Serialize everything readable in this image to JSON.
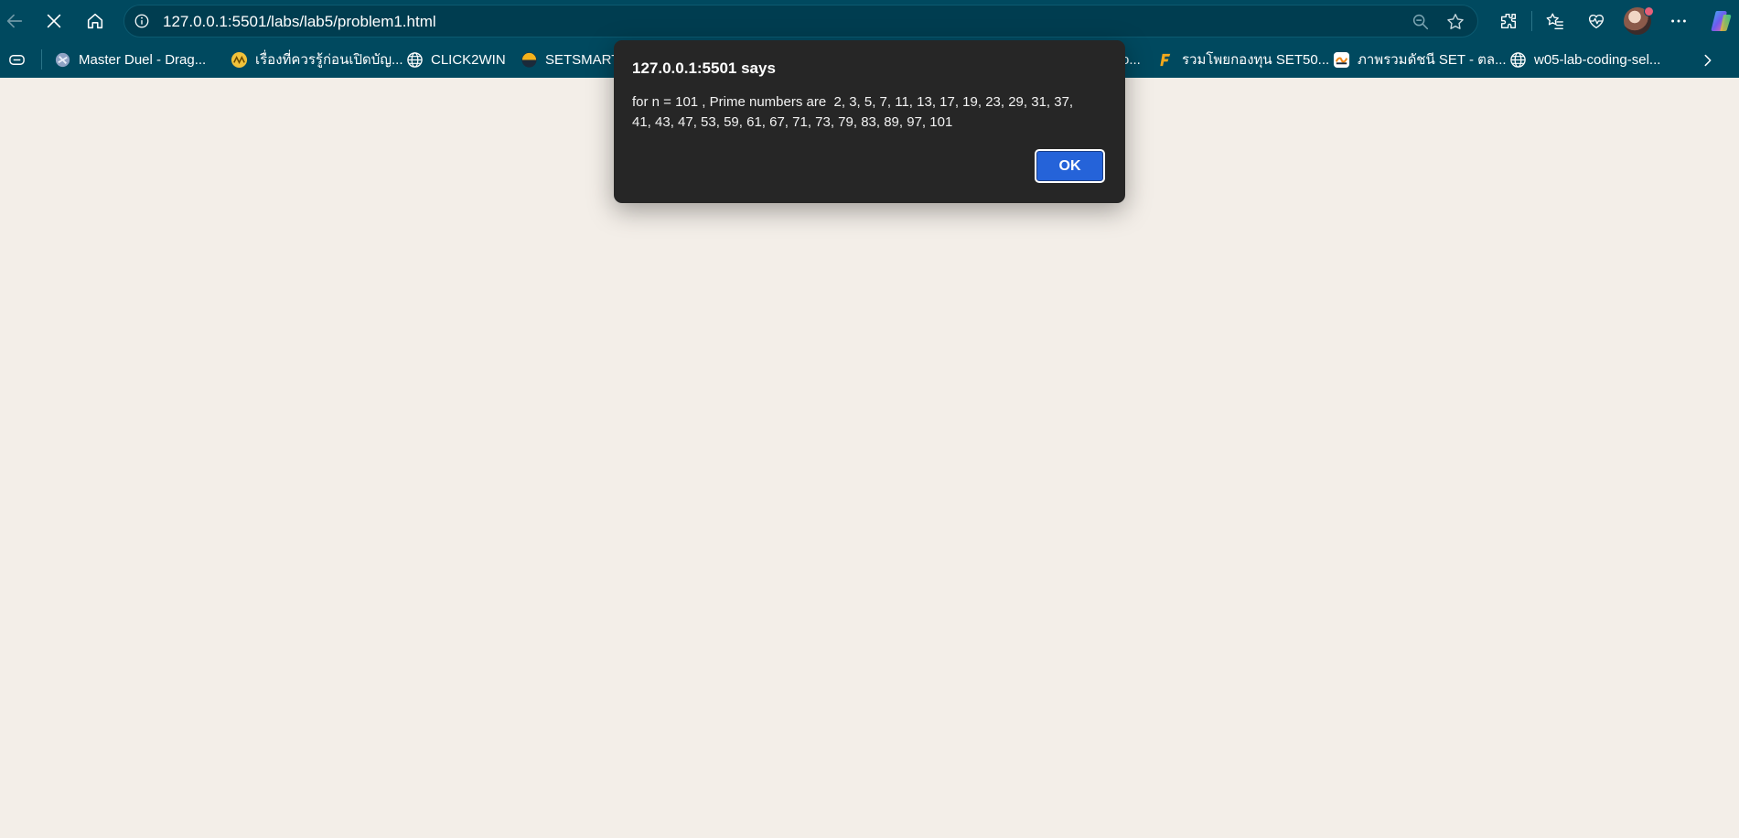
{
  "browser": {
    "url": "127.0.0.1:5501/labs/lab5/problem1.html",
    "colors": {
      "toolbar": "#00495f",
      "page_background": "#f3eee8"
    }
  },
  "bookmarks": [
    {
      "label": "Master Duel - Drag...",
      "icon": "game-favicon"
    },
    {
      "label": "เรื่องที่ควรรู้ก่อนเปิดบัญ...",
      "icon": "bank-favicon"
    },
    {
      "label": "CLICK2WIN",
      "icon": "globe-icon"
    },
    {
      "label": "SETSMART",
      "icon": "set-favicon"
    },
    {
      "label": "รวมโพยกองทุน SET50...",
      "icon": "f-favicon"
    },
    {
      "label": "ภาพรวมดัชนี SET - ตล...",
      "icon": "chart-favicon"
    },
    {
      "label": "w05-lab-coding-sel...",
      "icon": "globe-icon"
    }
  ],
  "dialog": {
    "title": "127.0.0.1:5501 says",
    "line1": "for n = 101 , Prime numbers are  2, 3, 5, 7, 11, 13, 17, 19, 23, 29, 31, 37,",
    "line2": "41, 43, 47, 53, 59, 61, 67, 71, 73, 79, 83, 89, 97, 101",
    "ok_label": "OK",
    "button_color": "#2563d9"
  }
}
